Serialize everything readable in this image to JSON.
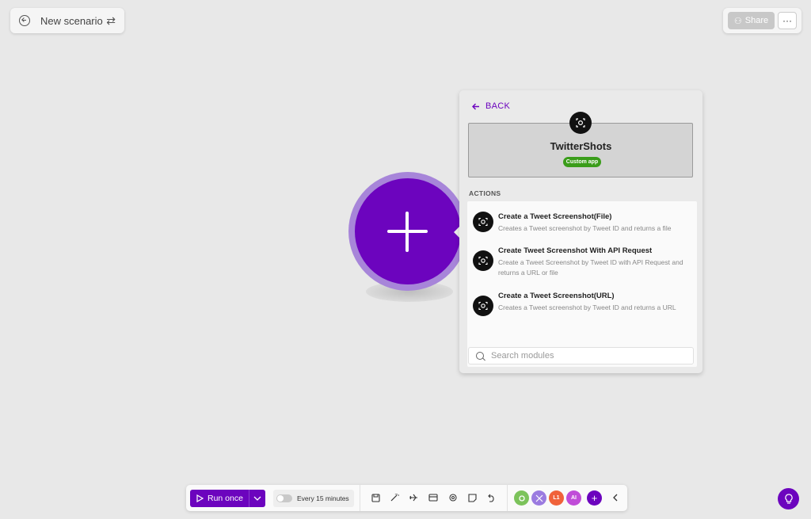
{
  "header": {
    "scenario_name": "New scenario",
    "share_label": "Share",
    "more_label": "···"
  },
  "panel": {
    "back_label": "BACK",
    "app_name": "TwitterShots",
    "badge": "Custom app",
    "section_title": "ACTIONS",
    "actions": [
      {
        "title": "Create a Tweet Screenshot(File)",
        "description": "Creates a Tweet screenshot by Tweet ID and returns a file"
      },
      {
        "title": "Create Tweet Screenshot With API Request",
        "description": "Create a Tweet Screenshot by Tweet ID with API Request and returns a URL or file"
      },
      {
        "title": "Create a Tweet Screenshot(URL)",
        "description": "Creates a Tweet screenshot by Tweet ID and returns a URL"
      }
    ],
    "search_placeholder": "Search modules"
  },
  "toolbar": {
    "run_label": "Run once",
    "schedule_label": "Every 15 minutes",
    "pills": [
      {
        "label": "",
        "color": "#7cc35b",
        "icon": "tools-icon"
      },
      {
        "label": "",
        "color": "#9b7be0",
        "icon": "flow-control-icon"
      },
      {
        "label": "L1",
        "color": "#f0623a"
      },
      {
        "label": "AI",
        "color": "#c04cd8"
      },
      {
        "label": "+",
        "color": "#6c04be"
      }
    ]
  },
  "colors": {
    "accent": "#6c04be",
    "badge": "#3a9d1a"
  }
}
